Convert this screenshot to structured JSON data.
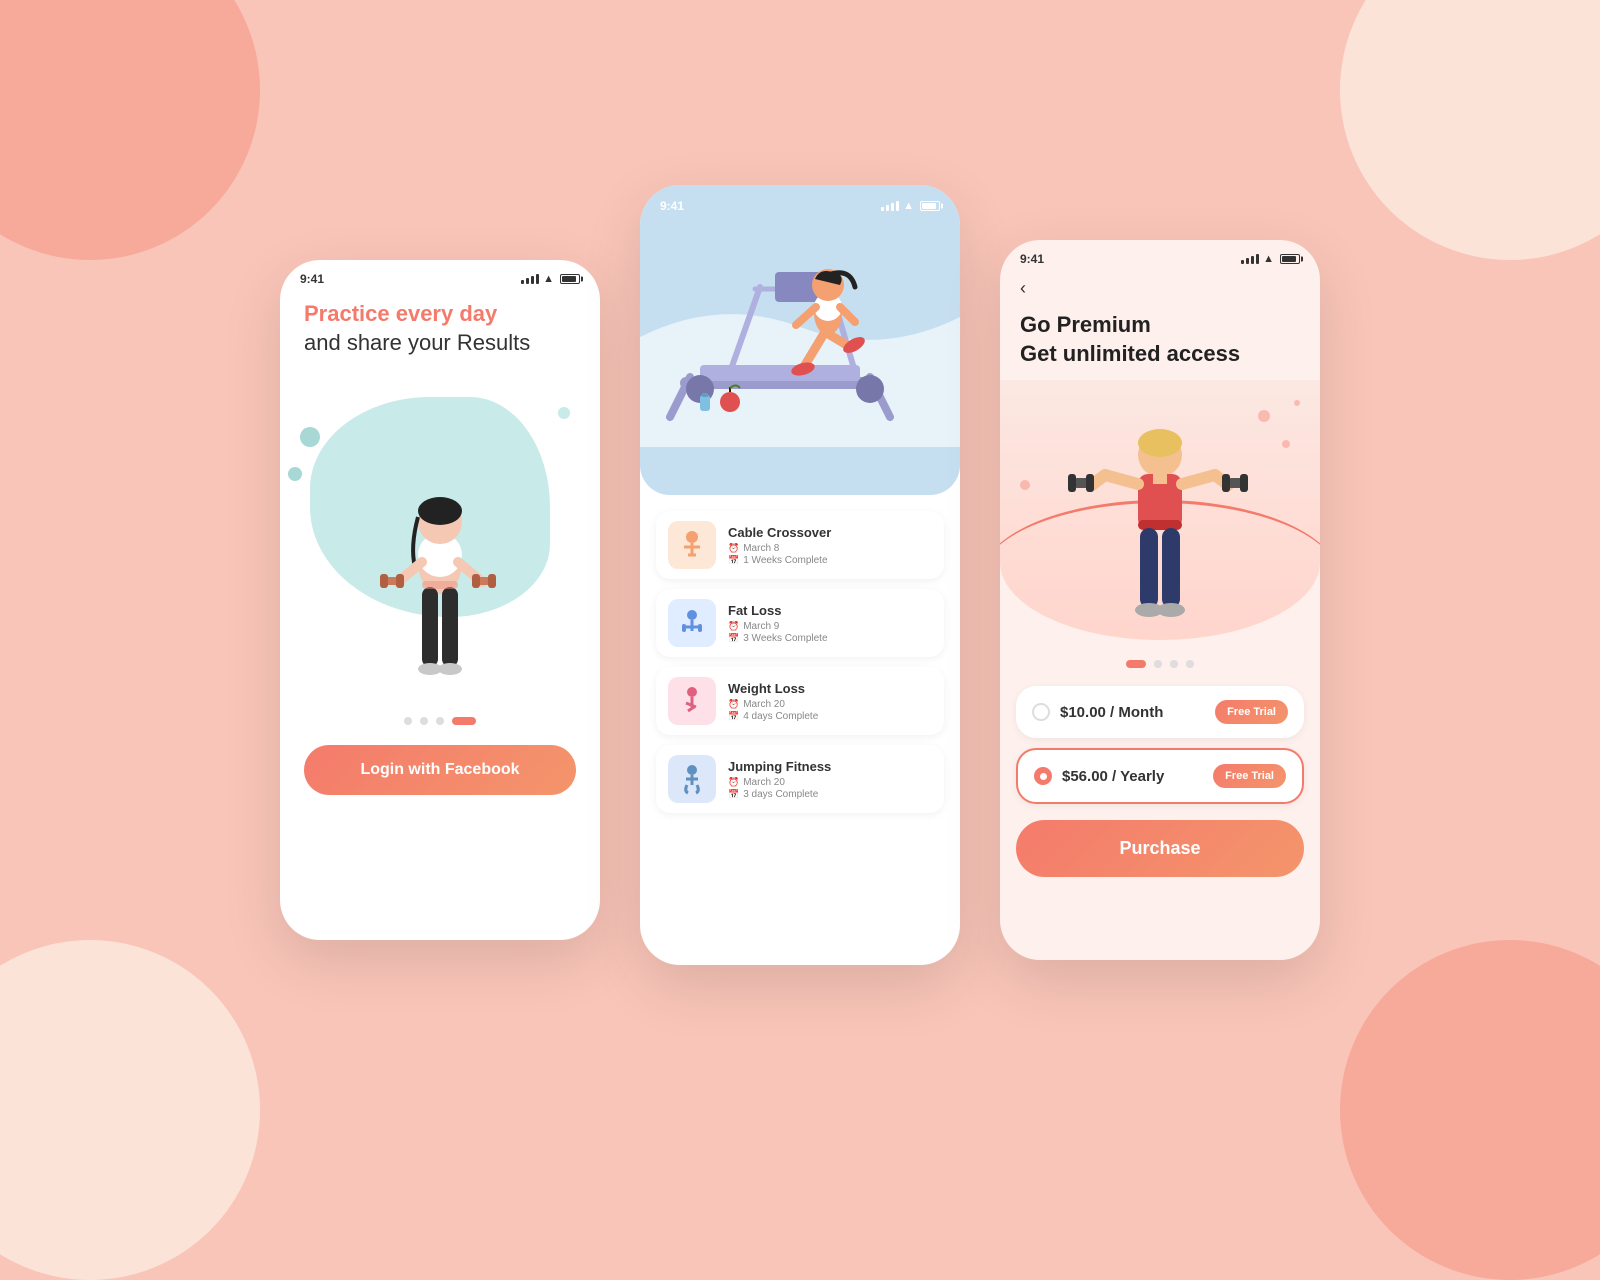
{
  "background": {
    "color": "#f9c5b8"
  },
  "phone1": {
    "status_time": "9:41",
    "tagline_accent": "Practice every day",
    "tagline_normal": "and share your Results",
    "dots": [
      "inactive",
      "inactive",
      "inactive",
      "active"
    ],
    "cta_button": "Login with Facebook"
  },
  "phone2": {
    "status_time": "9:41",
    "workouts": [
      {
        "name": "Cable Crossover",
        "date": "March 8",
        "progress": "1 Weeks Complete",
        "icon_color": "#fde8d8",
        "emoji": "🏋"
      },
      {
        "name": "Fat Loss",
        "date": "March 9",
        "progress": "3 Weeks Complete",
        "icon_color": "#e8f0fb",
        "emoji": "🏃"
      },
      {
        "name": "Weight Loss",
        "date": "March 20",
        "progress": "4 days Complete",
        "icon_color": "#fde0e8",
        "emoji": "🤸"
      },
      {
        "name": "Jumping Fitness",
        "date": "March 20",
        "progress": "3 days Complete",
        "icon_color": "#dce8fa",
        "emoji": "⛹"
      }
    ]
  },
  "phone3": {
    "status_time": "9:41",
    "back_label": "‹",
    "title_line1": "Go Premium",
    "title_line2": "Get unlimited access",
    "dots": [
      "active",
      "inactive",
      "inactive",
      "inactive"
    ],
    "plans": [
      {
        "label": "$10.00 / Month",
        "badge": "Free Trial",
        "selected": false
      },
      {
        "label": "$56.00 / Yearly",
        "badge": "Free Trial",
        "selected": true
      }
    ],
    "purchase_button": "Purchase"
  }
}
